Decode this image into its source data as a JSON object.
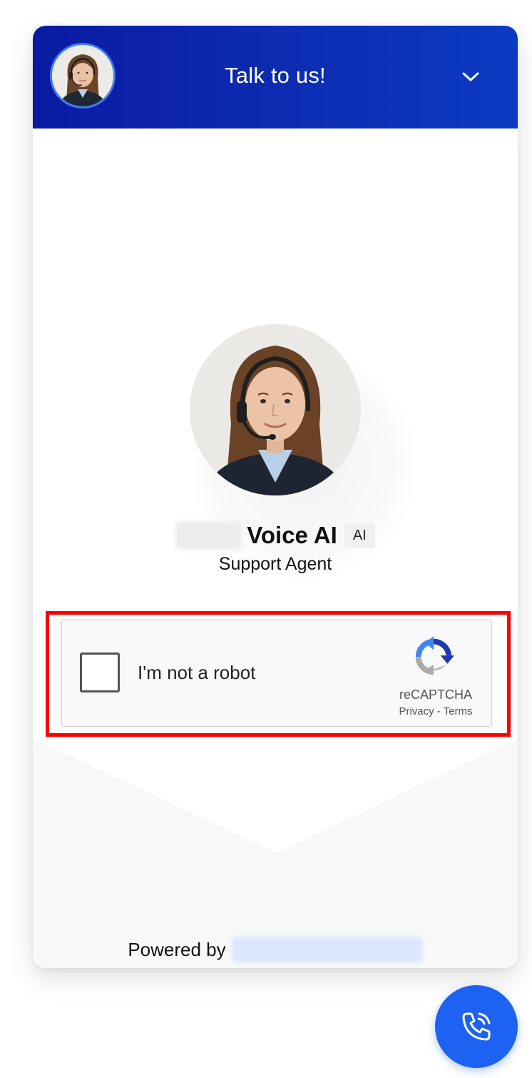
{
  "header": {
    "title": "Talk to us!",
    "avatar_icon": "agent-avatar-photo",
    "collapse_icon": "chevron-down-icon"
  },
  "agent": {
    "name": "Voice AI",
    "badge": "AI",
    "role": "Support Agent"
  },
  "recaptcha": {
    "checkbox_label": "I'm not a robot",
    "brand": "reCAPTCHA",
    "privacy_label": "Privacy",
    "separator": " - ",
    "terms_label": "Terms",
    "checked": false
  },
  "footer": {
    "powered_by_label": "Powered by"
  },
  "fab": {
    "icon": "phone-call-icon"
  },
  "colors": {
    "header_start": "#0a1aa3",
    "header_end": "#0b3bc2",
    "fab": "#1e62f2",
    "highlight": "#ff0000"
  }
}
